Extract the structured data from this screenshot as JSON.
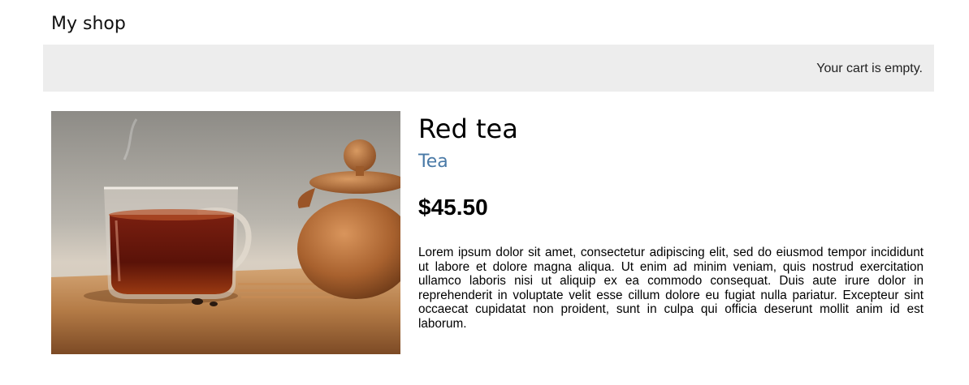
{
  "header": {
    "shop_name": "My shop"
  },
  "cart": {
    "status_text": "Your cart is empty."
  },
  "product": {
    "image_icon": "red-tea-photo",
    "name": "Red tea",
    "category": "Tea",
    "price": "$45.50",
    "description": "Lorem ipsum dolor sit amet, consectetur adipiscing elit, sed do eiusmod tempor incididunt ut labore et dolore magna aliqua. Ut enim ad minim veniam, quis nostrud exercitation ullamco laboris nisi ut aliquip ex ea commodo consequat. Duis aute irure dolor in reprehenderit in voluptate velit esse cillum dolore eu fugiat nulla pariatur. Excepteur sint occaecat cupidatat non proident, sunt in culpa qui officia deserunt mollit anim id est laborum."
  },
  "colors": {
    "cart_bar_bg": "#ededed",
    "category_link": "#4a7aa7"
  }
}
